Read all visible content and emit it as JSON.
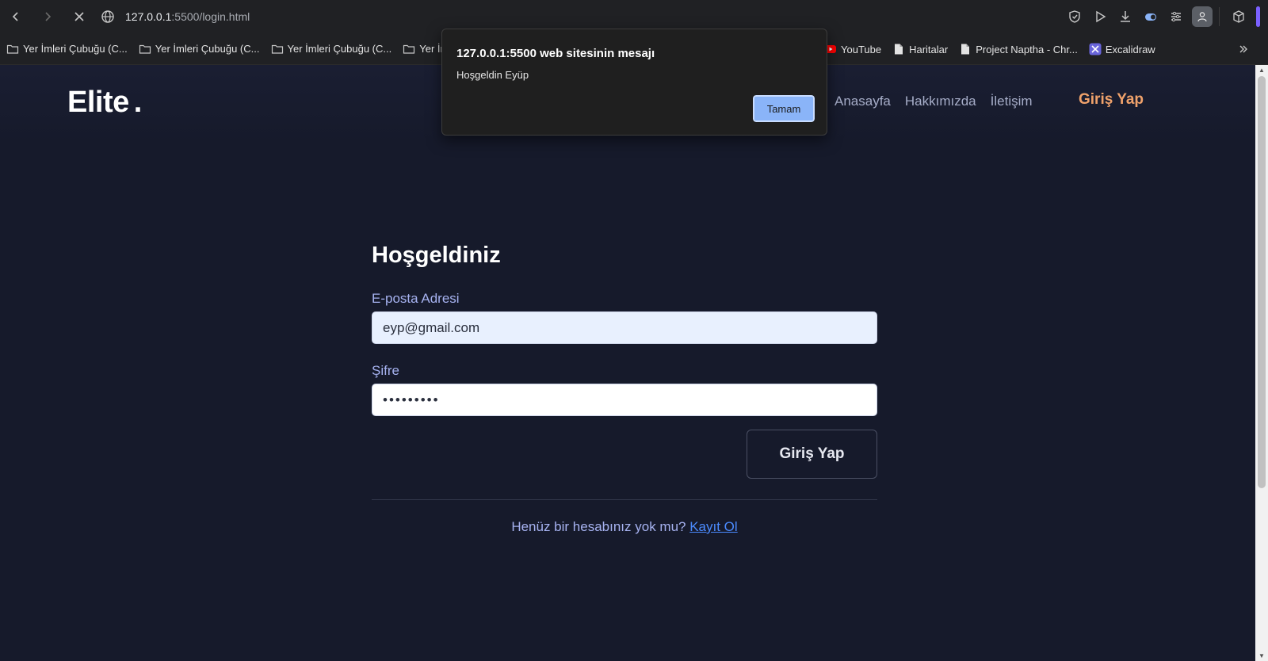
{
  "browser": {
    "url_host": "127.0.0.1",
    "url_rest": ":5500/login.html",
    "bookmarks": [
      {
        "label": "Yer İmleri Çubuğu (C...",
        "icon": "folder-icon"
      },
      {
        "label": "Yer İmleri Çubuğu (C...",
        "icon": "folder-icon"
      },
      {
        "label": "Yer İmleri Çubuğu (C...",
        "icon": "folder-icon"
      },
      {
        "label": "Yer İml",
        "icon": "folder-icon"
      }
    ],
    "bookmarks_right": [
      {
        "label": "YouTube",
        "icon": "youtube-icon"
      },
      {
        "label": "Haritalar",
        "icon": "page-icon"
      },
      {
        "label": "Project Naptha - Chr...",
        "icon": "page-icon"
      },
      {
        "label": "Excalidraw",
        "icon": "excalidraw-icon"
      }
    ]
  },
  "site": {
    "logo": "Elite",
    "logo_dot": ".",
    "nav": [
      "Anasayfa",
      "Hakkımızda",
      "İletişim"
    ],
    "login_link": "Giriş Yap"
  },
  "form": {
    "title": "Hoşgeldiniz",
    "email_label": "E-posta Adresi",
    "email_value": "eyp@gmail.com",
    "password_label": "Şifre",
    "password_value": "•••••••••",
    "submit_label": "Giriş Yap",
    "signup_prompt": "Henüz bir hesabınız yok mu?",
    "signup_link": "Kayıt Ol"
  },
  "dialog": {
    "title": "127.0.0.1:5500 web sitesinin mesajı",
    "message": "Hoşgeldin Eyüp",
    "ok_label": "Tamam"
  },
  "colors": {
    "page_bg": "#161a2b",
    "accent_orange": "#f0a26b",
    "label_blue": "#a6b2f0",
    "link_blue": "#4b8bff",
    "dialog_button": "#8ab4f8"
  }
}
